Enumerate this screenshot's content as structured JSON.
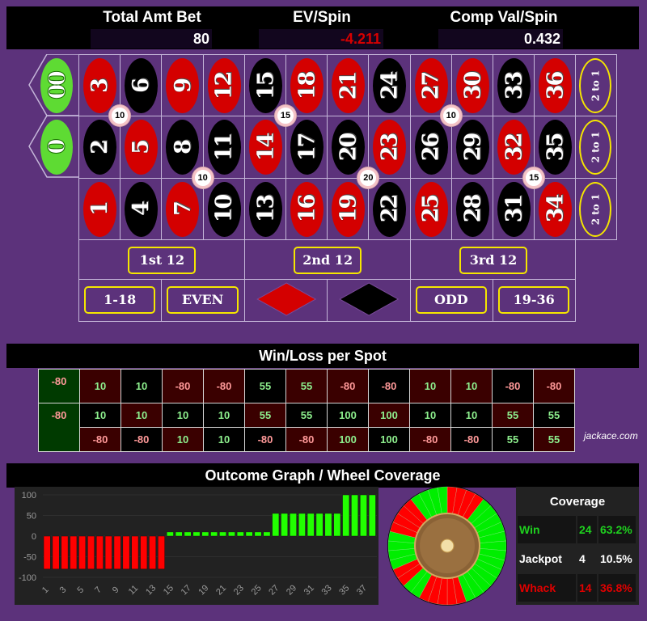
{
  "header": {
    "total_amt_bet_label": "Total Amt Bet",
    "total_amt_bet": "80",
    "ev_spin_label": "EV/Spin",
    "ev_spin": "-4.211",
    "comp_val_label": "Comp Val/Spin",
    "comp_val": "0.432"
  },
  "table": {
    "zeros": [
      "00",
      "0"
    ],
    "rows": [
      [
        {
          "n": "3",
          "c": "red"
        },
        {
          "n": "6",
          "c": "black"
        },
        {
          "n": "9",
          "c": "red"
        },
        {
          "n": "12",
          "c": "red"
        },
        {
          "n": "15",
          "c": "black"
        },
        {
          "n": "18",
          "c": "red"
        },
        {
          "n": "21",
          "c": "red"
        },
        {
          "n": "24",
          "c": "black"
        },
        {
          "n": "27",
          "c": "red"
        },
        {
          "n": "30",
          "c": "red"
        },
        {
          "n": "33",
          "c": "black"
        },
        {
          "n": "36",
          "c": "red"
        }
      ],
      [
        {
          "n": "2",
          "c": "black"
        },
        {
          "n": "5",
          "c": "red"
        },
        {
          "n": "8",
          "c": "black"
        },
        {
          "n": "11",
          "c": "black"
        },
        {
          "n": "14",
          "c": "red"
        },
        {
          "n": "17",
          "c": "black"
        },
        {
          "n": "20",
          "c": "black"
        },
        {
          "n": "23",
          "c": "red"
        },
        {
          "n": "26",
          "c": "black"
        },
        {
          "n": "29",
          "c": "black"
        },
        {
          "n": "32",
          "c": "red"
        },
        {
          "n": "35",
          "c": "black"
        }
      ],
      [
        {
          "n": "1",
          "c": "red"
        },
        {
          "n": "4",
          "c": "black"
        },
        {
          "n": "7",
          "c": "red"
        },
        {
          "n": "10",
          "c": "black"
        },
        {
          "n": "13",
          "c": "black"
        },
        {
          "n": "16",
          "c": "red"
        },
        {
          "n": "19",
          "c": "red"
        },
        {
          "n": "22",
          "c": "black"
        },
        {
          "n": "25",
          "c": "red"
        },
        {
          "n": "28",
          "c": "black"
        },
        {
          "n": "31",
          "c": "black"
        },
        {
          "n": "34",
          "c": "red"
        }
      ]
    ],
    "column_bets": [
      "2 to 1",
      "2 to 1",
      "2 to 1"
    ],
    "dozens": [
      "1st 12",
      "2nd 12",
      "3rd 12"
    ],
    "outside": [
      "1-18",
      "EVEN",
      "red-diamond",
      "black-diamond",
      "ODD",
      "19-36"
    ],
    "chips": [
      {
        "amount": "10",
        "between": [
          "3",
          "6",
          "2",
          "5"
        ]
      },
      {
        "amount": "15",
        "between": [
          "15",
          "18",
          "14",
          "17"
        ]
      },
      {
        "amount": "10",
        "between": [
          "27",
          "30",
          "26",
          "29"
        ]
      },
      {
        "amount": "10",
        "between": [
          "8",
          "11",
          "7",
          "10"
        ]
      },
      {
        "amount": "20",
        "between": [
          "20",
          "23",
          "19",
          "22"
        ]
      },
      {
        "amount": "15",
        "between": [
          "32",
          "35",
          "31",
          "34"
        ]
      }
    ]
  },
  "win_loss": {
    "title": "Win/Loss per Spot",
    "zeros": [
      "-80",
      "-80"
    ],
    "rows": [
      [
        "10",
        "10",
        "-80",
        "-80",
        "55",
        "55",
        "-80",
        "-80",
        "10",
        "10",
        "-80",
        "-80"
      ],
      [
        "10",
        "10",
        "10",
        "10",
        "55",
        "55",
        "100",
        "100",
        "10",
        "10",
        "55",
        "55"
      ],
      [
        "-80",
        "-80",
        "10",
        "10",
        "-80",
        "-80",
        "100",
        "100",
        "-80",
        "-80",
        "55",
        "55"
      ]
    ],
    "watermark": "jackace.com"
  },
  "outcome": {
    "title": "Outcome Graph / Wheel Coverage",
    "coverage": {
      "title": "Coverage",
      "rows": [
        {
          "label": "Win",
          "count": "24",
          "pct": "63.2%",
          "cls": "c-win"
        },
        {
          "label": "Jackpot",
          "count": "4",
          "pct": "10.5%",
          "cls": "c-jack"
        },
        {
          "label": "Whack",
          "count": "14",
          "pct": "36.8%",
          "cls": "c-whack"
        }
      ]
    },
    "colors": {
      "win": "#22ff00",
      "loss": "#ff0000"
    }
  },
  "chart_data": {
    "type": "bar",
    "title": "Outcome Graph",
    "xlabel": "",
    "ylabel": "",
    "ylim": [
      -100,
      100
    ],
    "yticks": [
      100,
      50,
      0,
      -50,
      -100
    ],
    "xtick_labels": [
      "1",
      "3",
      "5",
      "7",
      "9",
      "11",
      "13",
      "15",
      "17",
      "19",
      "21",
      "23",
      "25",
      "27",
      "29",
      "31",
      "33",
      "35",
      "37"
    ],
    "x": [
      1,
      2,
      3,
      4,
      5,
      6,
      7,
      8,
      9,
      10,
      11,
      12,
      13,
      14,
      15,
      16,
      17,
      18,
      19,
      20,
      21,
      22,
      23,
      24,
      25,
      26,
      27,
      28,
      29,
      30,
      31,
      32,
      33,
      34,
      35,
      36,
      37,
      38
    ],
    "values": [
      -80,
      -80,
      -80,
      -80,
      -80,
      -80,
      -80,
      -80,
      -80,
      -80,
      -80,
      -80,
      -80,
      -80,
      10,
      10,
      10,
      10,
      10,
      10,
      10,
      10,
      10,
      10,
      10,
      10,
      55,
      55,
      55,
      55,
      55,
      55,
      55,
      55,
      100,
      100,
      100,
      100
    ],
    "grid": true
  },
  "wheel_data": {
    "segments_clockwise_from_top": [
      "L",
      "L",
      "L",
      "L",
      "W",
      "W",
      "W",
      "W",
      "W",
      "W",
      "W",
      "W",
      "W",
      "W",
      "W",
      "W",
      "W",
      "L",
      "L",
      "L",
      "L",
      "L",
      "W",
      "W",
      "L",
      "L",
      "W",
      "W",
      "W",
      "W",
      "L",
      "L",
      "L",
      "L",
      "W",
      "W",
      "W",
      "W"
    ]
  }
}
